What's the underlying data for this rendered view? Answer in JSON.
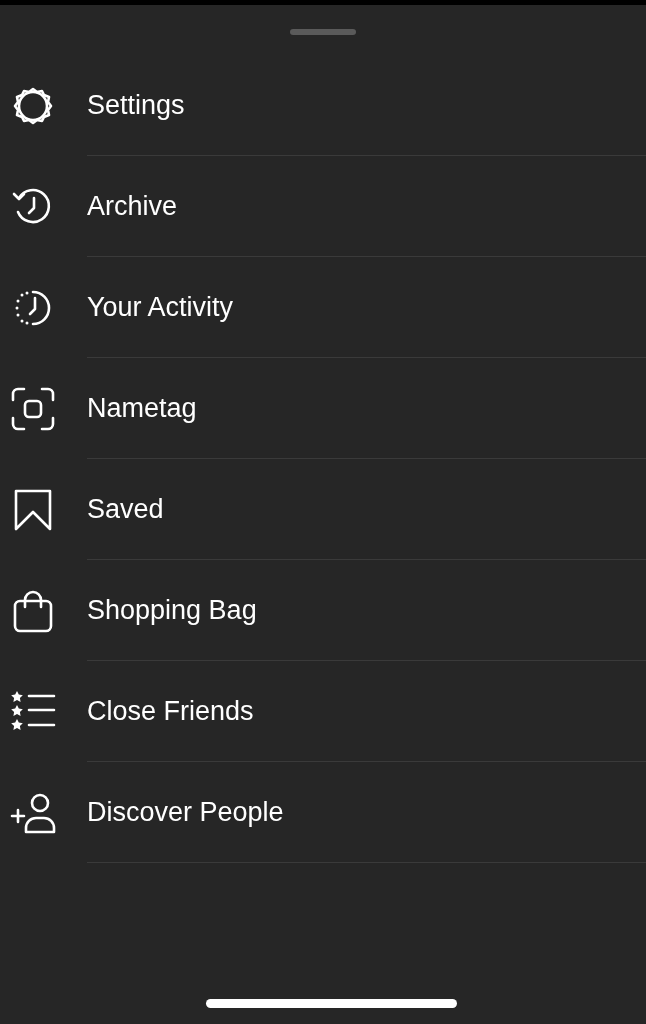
{
  "menu": {
    "items": [
      {
        "label": "Settings"
      },
      {
        "label": "Archive"
      },
      {
        "label": "Your Activity"
      },
      {
        "label": "Nametag"
      },
      {
        "label": "Saved"
      },
      {
        "label": "Shopping Bag"
      },
      {
        "label": "Close Friends"
      },
      {
        "label": "Discover People"
      }
    ]
  }
}
